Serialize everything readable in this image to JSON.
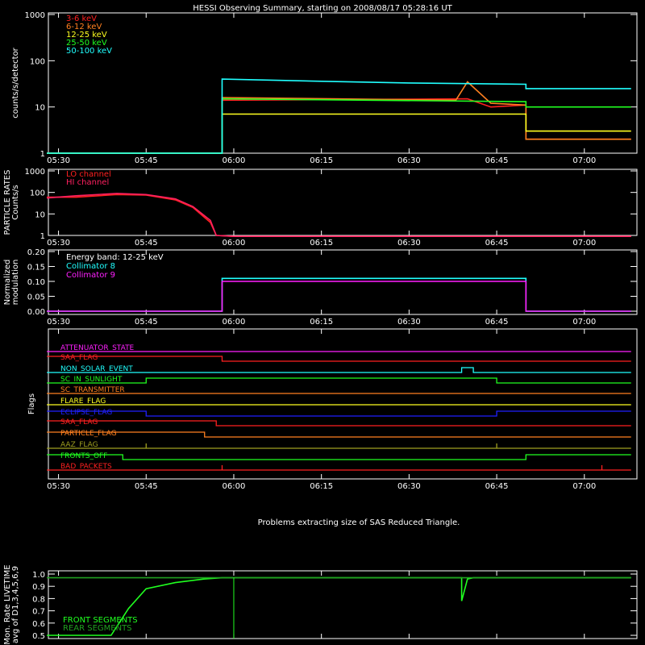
{
  "title": "HESSI Observing Summary, starting on 2008/08/17 05:28:16 UT",
  "time_ticks": [
    "05:30",
    "05:45",
    "06:00",
    "06:15",
    "06:30",
    "06:45",
    "07:00"
  ],
  "notice": "Problems extracting size of SAS Reduced Triangle.",
  "chart_data": [
    {
      "type": "line",
      "ylabel": "counts/s/detector",
      "log": true,
      "yticks": [
        "1",
        "10",
        "100",
        "1000"
      ],
      "series": [
        {
          "name": "3-6 keV",
          "color": "#ff2020",
          "x": [
            "05:28",
            "05:58",
            "05:58",
            "06:40",
            "06:44",
            "06:50",
            "06:50",
            "07:08"
          ],
          "values": [
            1,
            1,
            14,
            15,
            10,
            11,
            2,
            2
          ]
        },
        {
          "name": "6-12 keV",
          "color": "#ff8020",
          "x": [
            "05:28",
            "05:58",
            "05:58",
            "06:38",
            "06:40",
            "06:44",
            "06:50",
            "06:50",
            "07:08"
          ],
          "values": [
            1,
            1,
            16,
            14,
            35,
            12,
            11,
            2,
            2
          ]
        },
        {
          "name": "12-25 keV",
          "color": "#ffff20",
          "x": [
            "05:28",
            "05:58",
            "05:58",
            "06:50",
            "06:50",
            "07:08"
          ],
          "values": [
            1,
            1,
            7,
            7,
            3,
            3
          ]
        },
        {
          "name": "25-50 keV",
          "color": "#20ff20",
          "x": [
            "05:28",
            "05:58",
            "05:58",
            "06:50",
            "06:50",
            "07:08"
          ],
          "values": [
            1,
            1,
            15,
            13,
            10,
            10
          ]
        },
        {
          "name": "50-100 keV",
          "color": "#20ffff",
          "x": [
            "05:28",
            "05:58",
            "05:58",
            "06:15",
            "06:30",
            "06:50",
            "06:50",
            "07:08"
          ],
          "values": [
            1,
            1,
            40,
            36,
            33,
            31,
            25,
            25
          ]
        }
      ]
    },
    {
      "type": "line",
      "ylabel": "PARTICLE RATES Counts/s",
      "log": true,
      "yticks": [
        "1",
        "10",
        "100",
        "1000"
      ],
      "series": [
        {
          "name": "LO channel",
          "color": "#ff2020",
          "x": [
            "05:28",
            "05:33",
            "05:40",
            "05:45",
            "05:50",
            "05:53",
            "05:56",
            "05:57",
            "06:00",
            "07:08"
          ],
          "values": [
            60,
            60,
            80,
            75,
            45,
            20,
            4,
            1,
            0.9,
            0.9
          ]
        },
        {
          "name": "HI channel",
          "color": "#ff2060",
          "x": [
            "05:28",
            "05:33",
            "05:40",
            "05:45",
            "05:50",
            "05:53",
            "05:56",
            "05:57",
            "06:00",
            "07:08"
          ],
          "values": [
            55,
            70,
            90,
            80,
            50,
            22,
            5,
            1,
            0.9,
            0.9
          ]
        }
      ]
    },
    {
      "type": "line",
      "ylabel": "Normalized modulation",
      "annotation": "Energy band: 12-25 keV",
      "yticks": [
        "0.00",
        "0.05",
        "0.10",
        "0.15",
        "0.20"
      ],
      "ylim": [
        0,
        0.2
      ],
      "series": [
        {
          "name": "Collimator 8",
          "color": "#20ffff",
          "x": [
            "05:28",
            "05:58",
            "05:58",
            "06:50",
            "06:50",
            "07:08"
          ],
          "values": [
            0,
            0,
            0.11,
            0.11,
            0,
            0
          ]
        },
        {
          "name": "Collimator 9",
          "color": "#ff20ff",
          "x": [
            "05:28",
            "05:58",
            "05:58",
            "06:50",
            "06:50",
            "07:08"
          ],
          "values": [
            0,
            0,
            0.1,
            0.1,
            0,
            0
          ]
        }
      ]
    },
    {
      "type": "line",
      "ylabel": "Flags",
      "series": [
        {
          "name": "ATTENUATOR_STATE",
          "color": "#ff20ff",
          "x": [
            "05:28",
            "07:08"
          ],
          "values": [
            0,
            0
          ]
        },
        {
          "name": "SAA_FLAG",
          "color": "#ff2020",
          "x": [
            "05:28",
            "05:58",
            "05:58",
            "07:08"
          ],
          "values": [
            1,
            1,
            0,
            0
          ]
        },
        {
          "name": "NON_SOLAR_EVENT",
          "color": "#20ffff",
          "x": [
            "05:28",
            "06:39",
            "06:39",
            "06:41",
            "06:41",
            "07:08"
          ],
          "values": [
            0,
            0,
            1,
            1,
            0,
            0
          ]
        },
        {
          "name": "SC_IN_SUNLIGHT",
          "color": "#20ff20",
          "x": [
            "05:28",
            "05:45",
            "05:45",
            "06:45",
            "06:45",
            "07:08"
          ],
          "values": [
            0,
            0,
            1,
            1,
            0,
            0
          ]
        },
        {
          "name": "SC_TRANSMITTER",
          "color": "#ff8020",
          "x": [
            "05:28",
            "07:08"
          ],
          "values": [
            0,
            0
          ]
        },
        {
          "name": "FLARE_FLAG",
          "color": "#ffff20",
          "x": [
            "05:28",
            "07:08"
          ],
          "values": [
            0,
            0
          ]
        },
        {
          "name": "ECLIPSE_FLAG",
          "color": "#2020ff",
          "x": [
            "05:28",
            "05:45",
            "05:45",
            "06:45",
            "06:45",
            "07:08"
          ],
          "values": [
            1,
            1,
            0,
            0,
            1,
            1
          ]
        },
        {
          "name": "SAA_FLAG",
          "color": "#ff2020",
          "x": [
            "05:28",
            "05:57",
            "05:57",
            "07:08"
          ],
          "values": [
            1,
            1,
            0,
            0
          ]
        },
        {
          "name": "PARTICLE_FLAG",
          "color": "#ff8020",
          "x": [
            "05:28",
            "05:55",
            "05:55",
            "07:08"
          ],
          "values": [
            1,
            1,
            0,
            0
          ]
        },
        {
          "name": "AAZ_FLAG",
          "color": "#a0a020",
          "x": [
            "05:28",
            "05:45",
            "05:45",
            "05:45",
            "06:45",
            "06:45",
            "06:45",
            "07:08"
          ],
          "values": [
            0,
            0,
            1,
            0,
            0,
            1,
            0,
            0
          ]
        },
        {
          "name": "FRONTS_OFF",
          "color": "#20ff20",
          "x": [
            "05:28",
            "05:41",
            "05:41",
            "06:50",
            "06:50",
            "07:08"
          ],
          "values": [
            1,
            1,
            0,
            0,
            1,
            1
          ]
        },
        {
          "name": "BAD_PACKETS",
          "color": "#ff2020",
          "x": [
            "05:28",
            "05:58",
            "05:58",
            "05:58",
            "07:03",
            "07:03",
            "07:03",
            "07:08"
          ],
          "values": [
            0,
            0,
            1,
            0,
            0,
            1,
            0,
            0
          ]
        }
      ]
    },
    {
      "type": "line",
      "ylabel": "Mon. Rate LIVETIME avg of D1,3,4,5,6,9",
      "yticks": [
        "0.5",
        "0.6",
        "0.7",
        "0.8",
        "0.9",
        "1.0"
      ],
      "ylim": [
        0.5,
        1.0
      ],
      "series": [
        {
          "name": "FRONT SEGMENTS",
          "color": "#20ff20",
          "x": [
            "05:28",
            "05:39",
            "05:42",
            "05:45",
            "05:50",
            "05:55",
            "05:58",
            "06:39",
            "06:39",
            "06:40",
            "06:41",
            "07:08"
          ],
          "values": [
            0.5,
            0.5,
            0.72,
            0.88,
            0.93,
            0.96,
            0.97,
            0.97,
            0.78,
            0.96,
            0.97,
            0.97
          ]
        },
        {
          "name": "REAR SEGMENTS",
          "color": "#20a020",
          "x": [
            "05:28",
            "07:08"
          ],
          "values": [
            0.97,
            0.97
          ]
        }
      ]
    }
  ]
}
